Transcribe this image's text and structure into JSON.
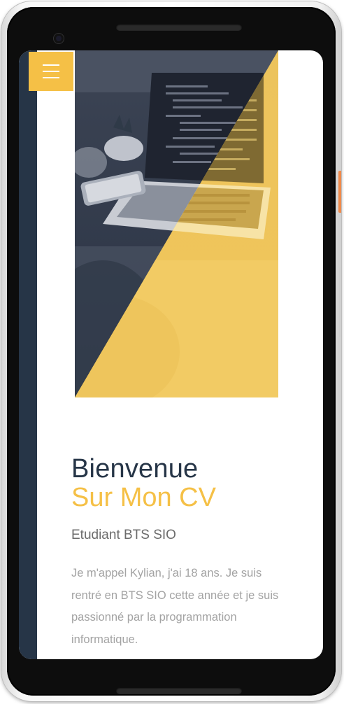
{
  "menu": {
    "icon": "hamburger-menu-icon"
  },
  "hero": {
    "image": "desk-laptop-photo-with-yellow-diagonal-overlay"
  },
  "heading": {
    "line1": "Bienvenue",
    "line2": "Sur Mon CV"
  },
  "subtitle": "Etudiant BTS SIO",
  "intro": "Je m'appel Kylian, j'ai 18 ans. Je suis rentré en BTS SIO cette année et je suis passionné par la programmation informatique.",
  "colors": {
    "accent": "#f5c046",
    "dark": "#263547",
    "muted": "#a3a3a3"
  }
}
